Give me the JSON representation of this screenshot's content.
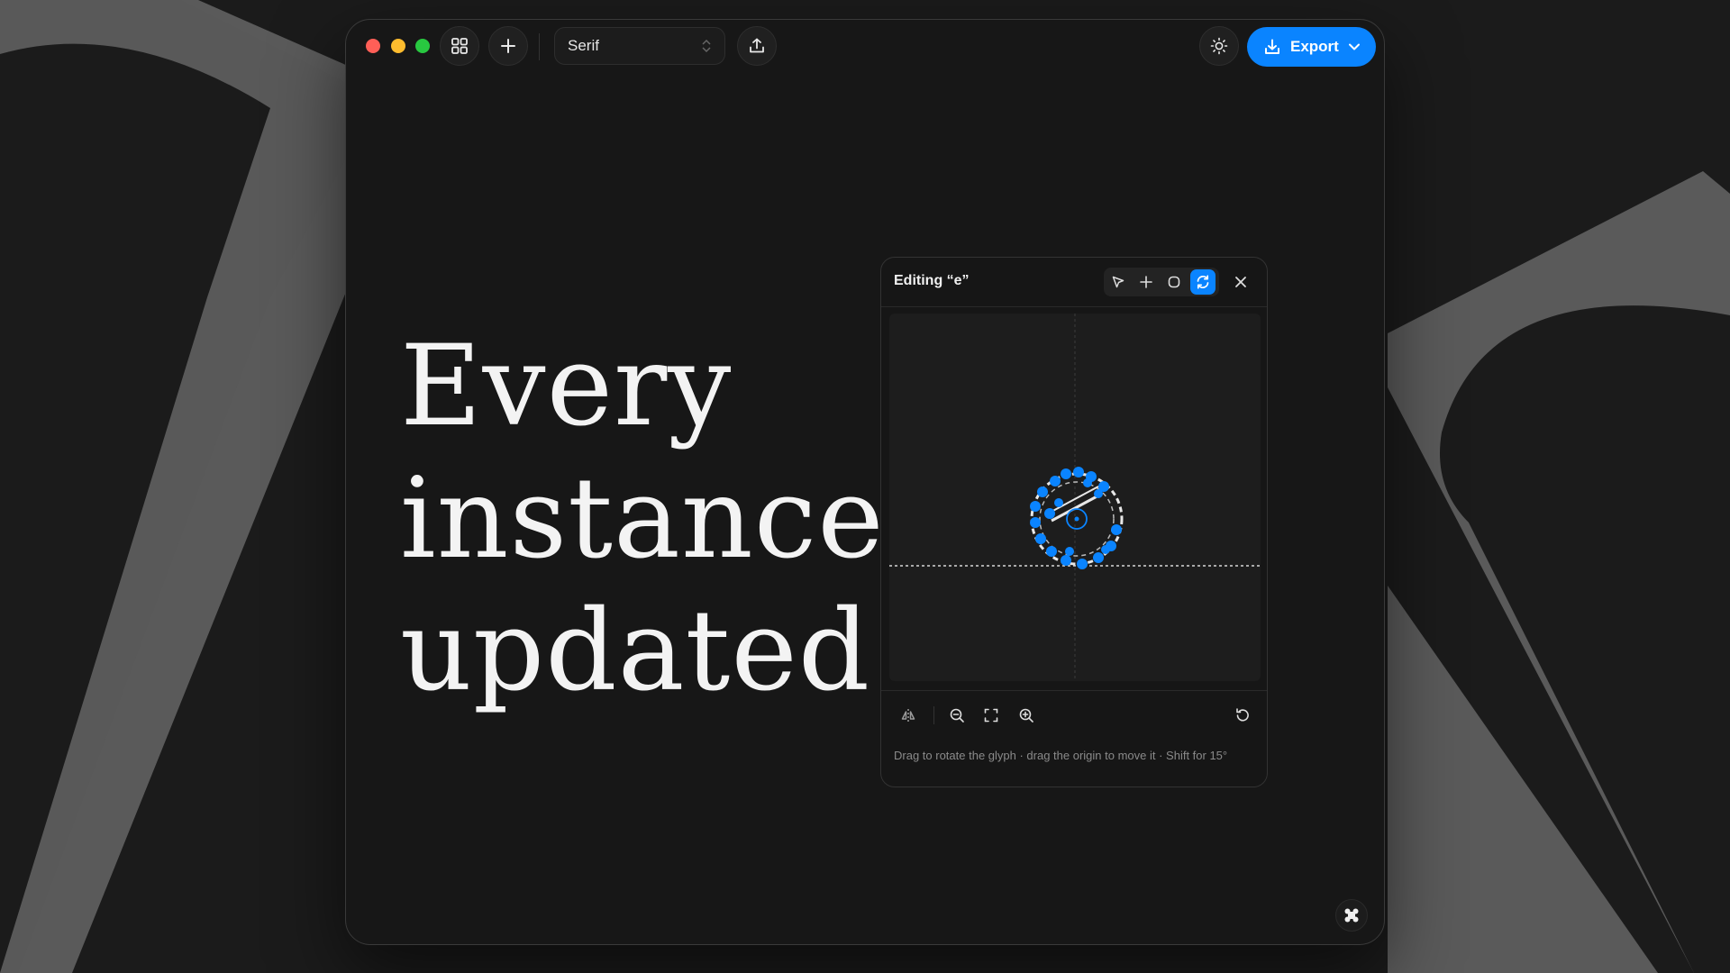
{
  "colors": {
    "accent": "#0a84ff",
    "background": "#1b1b1b",
    "window": "#171717",
    "text": "#f3f3f3",
    "muted": "#8a8a8a"
  },
  "toolbar": {
    "font_select": {
      "value": "Serif"
    },
    "export_label": "Export",
    "icons": [
      "grid-icon",
      "plus-icon",
      "chevron-updown-icon",
      "upload-icon",
      "sun-icon",
      "download-icon",
      "chevron-down-icon"
    ]
  },
  "headline": {
    "lines": [
      "Every",
      "instance",
      "updated"
    ]
  },
  "glyph_editor": {
    "title": "Editing “e”",
    "active_tool": "rotate",
    "tools": [
      "select-arrow-icon",
      "add-point-icon",
      "shape-icon",
      "rotate-icon"
    ],
    "footer_tools": [
      "flip-icon",
      "zoom-out-icon",
      "fit-icon",
      "zoom-in-icon",
      "reset-icon"
    ],
    "hint": "Drag to rotate the glyph · drag the origin to move it · Shift for 15°"
  }
}
